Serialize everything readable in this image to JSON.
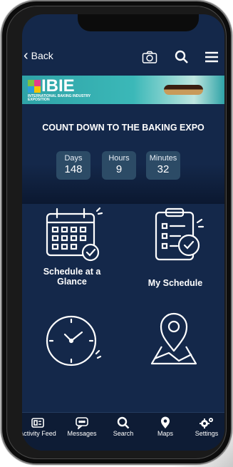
{
  "topbar": {
    "back_label": "Back",
    "icons": [
      "camera-icon",
      "search-icon",
      "menu-icon"
    ]
  },
  "banner": {
    "logo_text": "IBIE",
    "logo_subtext": "INTERNATIONAL BAKING INDUSTRY EXPOSITION"
  },
  "countdown": {
    "title": "COUNT DOWN TO THE BAKING EXPO",
    "days_label": "Days",
    "days_value": "148",
    "hours_label": "Hours",
    "hours_value": "9",
    "minutes_label": "Minutes",
    "minutes_value": "32"
  },
  "tiles": [
    {
      "label": "Schedule at a Glance",
      "icon": "calendar-check-icon"
    },
    {
      "label": "My Schedule",
      "icon": "clipboard-check-icon"
    },
    {
      "label": "",
      "icon": "clock-icon"
    },
    {
      "label": "",
      "icon": "map-pin-icon"
    }
  ],
  "bottom_nav": [
    {
      "label": "Activity Feed",
      "icon": "activity-feed-icon"
    },
    {
      "label": "Messages",
      "icon": "messages-icon"
    },
    {
      "label": "Search",
      "icon": "search-icon"
    },
    {
      "label": "Maps",
      "icon": "location-pin-icon"
    },
    {
      "label": "Settings",
      "icon": "settings-gear-icon"
    }
  ]
}
